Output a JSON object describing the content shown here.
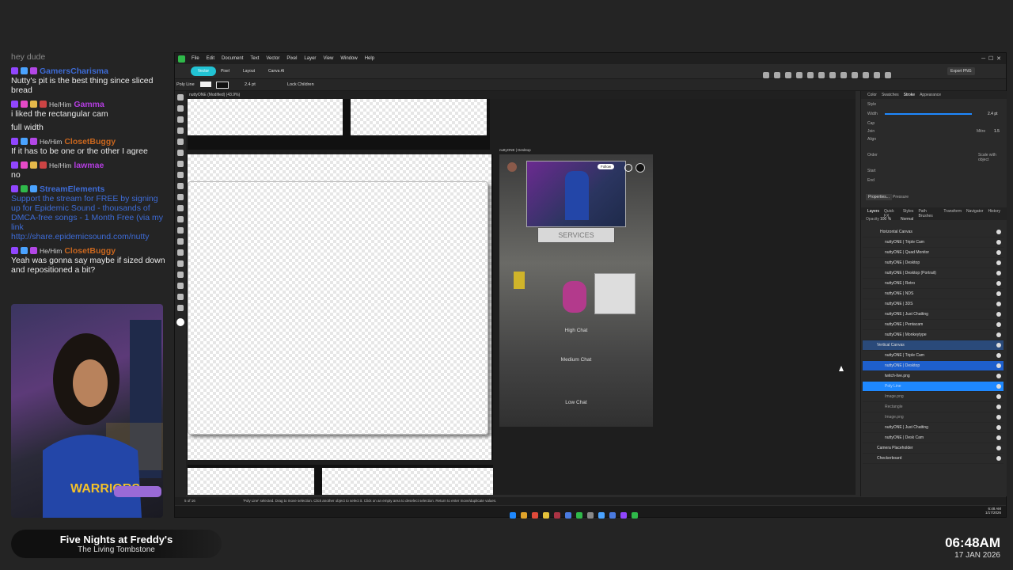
{
  "chat": {
    "messages": [
      {
        "user": "",
        "pronoun": "",
        "text": "hey dude",
        "color": "#9a9a9a"
      },
      {
        "user": "GamersCharisma",
        "pronoun": "",
        "text": "Nutty's pit is the best thing since sliced bread",
        "color": "#3d6bd6"
      },
      {
        "user": "Gamma",
        "pronoun": "He/Him",
        "text": "i liked the rectangular cam",
        "color": "#b43de0"
      },
      {
        "user": "",
        "pronoun": "",
        "text": "full width",
        "color": "#eaeaea"
      },
      {
        "user": "ClosetBuggy",
        "pronoun": "He/Him",
        "text": "If it has to be one or the other I agree",
        "color": "#c9661e"
      },
      {
        "user": "lawmae",
        "pronoun": "He/Him",
        "text": "no",
        "color": "#b43de0"
      },
      {
        "user": "StreamElements",
        "pronoun": "",
        "text": "Support the stream for FREE by signing up for Epidemic Sound - thousands of DMCA-free songs - 1 Month Free (via my link",
        "color": "#3d6bd6"
      },
      {
        "user": "",
        "pronoun": "",
        "text": "http://share.epidemicsound.com/nutty",
        "color": "#3d6bd6"
      },
      {
        "user": "ClosetBuggy",
        "pronoun": "He/Him",
        "text": "Yeah was gonna say maybe if sized down and repositioned a bit?",
        "color": "#c9661e"
      }
    ]
  },
  "now_playing": {
    "title": "Five Nights at Freddy's",
    "subtitle": "The Living Tombstone"
  },
  "clock": {
    "time": "06:48AM",
    "date": "17 JAN 2026"
  },
  "app": {
    "menu": [
      "File",
      "Edit",
      "Document",
      "Text",
      "Vector",
      "Pixel",
      "Layer",
      "View",
      "Window",
      "Help"
    ],
    "personas": [
      "Vector",
      "Pixel",
      "Layout",
      "Canva AI"
    ],
    "export_label": "Export PNG",
    "context": {
      "tool": "Poly Line",
      "stroke": "2.4 pt",
      "lock_children": "Lock Children"
    },
    "doc_tab": "nuttyONE (Modified) (43.9%)",
    "artboard_label": "nuttyONE | Desktop",
    "overlay": {
      "follow": "Follow",
      "high": "High Chat",
      "medium": "Medium Chat",
      "low": "Low Chat",
      "services": "SERVICES"
    },
    "status": "'Poly Line' selected. Drag to move selection. Click another object to select it. Click on an empty area to deselect selection. Return to enter move/duplicate values.",
    "page_indicator": "5 of 16",
    "panel_tabs": [
      "Color",
      "Swatches",
      "Stroke",
      "Appearance"
    ],
    "stroke": {
      "style": "Style",
      "width": "Width",
      "width_val": "2.4 pt",
      "cap": "Cap",
      "join": "Join",
      "mitre": "Mitre",
      "mitre_val": "1.5",
      "align": "Align",
      "order": "Order",
      "scale": "Scale with object",
      "start": "Start",
      "end": "End",
      "properties": "Properties...",
      "pressure": "Pressure"
    },
    "layer_tabs": [
      "Layers",
      "Quick FX",
      "Styles",
      "Path Brushes",
      "Transform",
      "Navigator",
      "History"
    ],
    "opacity": {
      "label": "Opacity",
      "value": "100 %",
      "blend": "Normal"
    },
    "layers": [
      "Horizontal Canvas",
      "nuttyONE | Triple Cam",
      "nuttyONE | Quad Monitor",
      "nuttyONE | Desktop",
      "nuttyONE | Desktop (Portrait)",
      "nuttyONE | Retro",
      "nuttyONE | NDS",
      "nuttyONE | 3DS",
      "nuttyONE | Just Chatting",
      "nuttyONE | Pentacam",
      "nuttyONE | Monkeytype",
      "Vertical Canvas",
      "nuttyONE | Triple Cam",
      "nuttyONE | Desktop",
      "twitch-live.png",
      "Poly Line",
      "Image.png",
      "Rectangle",
      "Image.png",
      "nuttyONE | Just Chatting",
      "nuttyONE | Desk Cam",
      "Camera Placeholder",
      "Checkerboard"
    ],
    "tray": {
      "time": "6:48 AM",
      "date": "1/17/2026"
    }
  },
  "colors": {
    "accent": "#1e88ff",
    "persona": "#22c3d4",
    "bg": "#242424"
  }
}
